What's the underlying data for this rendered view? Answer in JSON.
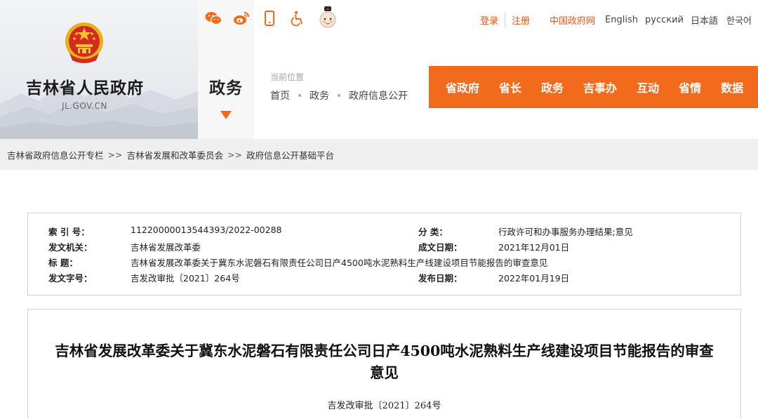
{
  "header": {
    "site_name": "吉林省人民政府",
    "site_domain": "JL.GOV.CN",
    "section_title": "政务",
    "icons": [
      "wechat-icon",
      "weibo-icon",
      "mobile-icon",
      "accessibility-icon",
      "mascot-icon"
    ],
    "top_links": {
      "login": "登录",
      "register": "注册",
      "china_gov": "中国政府网",
      "english": "English",
      "russian": "русский",
      "japanese": "日本語",
      "korean": "한국어"
    },
    "location_label": "当前位置",
    "breadcrumb": [
      "首页",
      "政务",
      "政府信息公开"
    ],
    "nav": [
      "省政府",
      "省长",
      "政务",
      "吉事办",
      "互动",
      "省情",
      "数据"
    ]
  },
  "crumb_bar": [
    "吉林省政府信息公开专栏",
    "吉林省发展和改革委员会",
    "政府信息公开基础平台"
  ],
  "crumb_sep": ">>",
  "meta": {
    "index_label": "索 引 号：",
    "index_value": "11220000013544393/2022-00288",
    "category_label": "分 类：",
    "category_value": "行政许可和办事服务办理结果;意见",
    "issuer_label": "发文机关：",
    "issuer_value": "吉林省发展改革委",
    "created_label": "成文日期：",
    "created_value": "2021年12月01日",
    "title_label": "标 题：",
    "title_value": "吉林省发展改革委关于冀东水泥磐石有限责任公司日产4500吨水泥熟料生产线建设项目节能报告的审查意见",
    "docno_label": "发文字号：",
    "docno_value": "吉发改审批〔2021〕264号",
    "published_label": "发布日期：",
    "published_value": "2022年01月19日"
  },
  "article": {
    "title": "吉林省发展改革委关于冀东水泥磐石有限责任公司日产4500吨水泥熟料生产线建设项目节能报告的审查意见",
    "doc_number": "吉发改审批〔2021〕264号"
  },
  "colors": {
    "accent": "#f26b1d",
    "link_orange": "#e2571a"
  }
}
